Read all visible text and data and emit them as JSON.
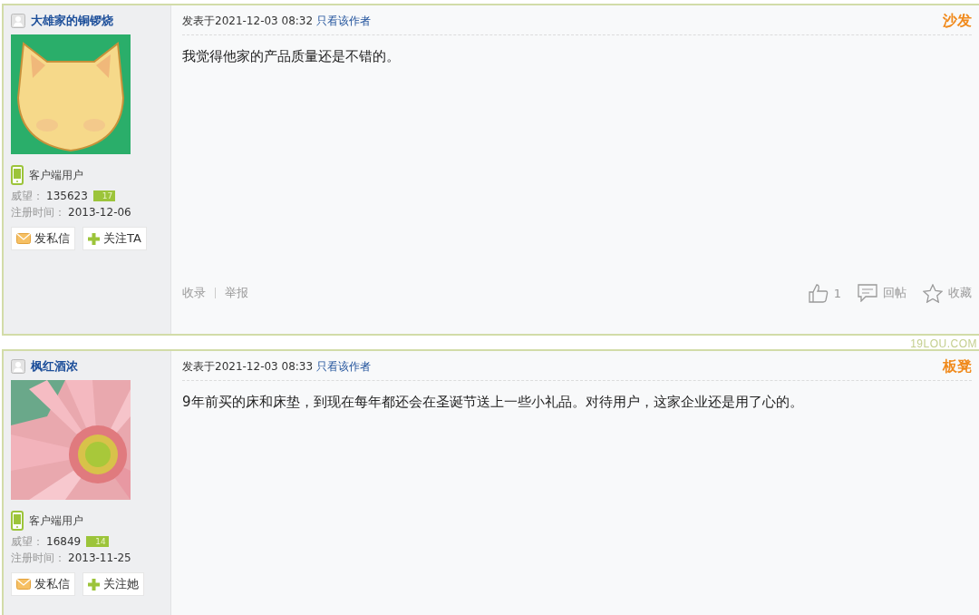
{
  "posts": [
    {
      "author": "大雄家的铜锣烧",
      "client_label": "客户端用户",
      "reputation_label": "威望：",
      "reputation": "135623",
      "level_badge": "17",
      "registered_label": "注册时间：",
      "registered": "2013-12-06",
      "message_button": "发私信",
      "follow_button": "关注TA",
      "posted": "发表于2021-12-03 08:32",
      "author_only_link": "只看该作者",
      "floor": "沙发",
      "body": "我觉得他家的产品质量还是不错的。",
      "footer": {
        "left_links": [
          "收录",
          "举报"
        ],
        "likes": "1",
        "reply": "回帖",
        "favorite": "收藏"
      }
    },
    {
      "author": "枫红酒浓",
      "client_label": "客户端用户",
      "reputation_label": "威望：",
      "reputation": "16849",
      "level_badge": "14",
      "registered_label": "注册时间：",
      "registered": "2013-11-25",
      "message_button": "发私信",
      "follow_button": "关注她",
      "posted": "发表于2021-12-03 08:33",
      "author_only_link": "只看该作者",
      "floor": "板凳",
      "body": "9年前买的床和床垫，到现在每年都还会在圣诞节送上一些小礼品。对待用户，这家企业还是用了心的。"
    }
  ],
  "separator_mark": "19LOU.COM"
}
